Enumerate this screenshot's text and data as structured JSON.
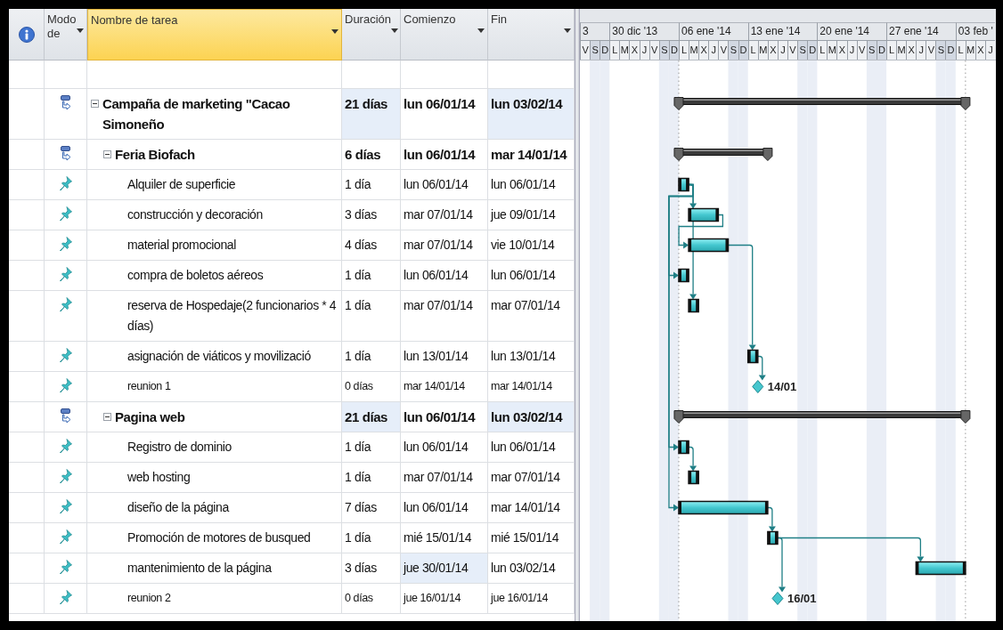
{
  "columns": [
    {
      "label": "Modo de",
      "selected": false
    },
    {
      "label": "Nombre de tarea",
      "selected": true
    },
    {
      "label": "Duración",
      "selected": false
    },
    {
      "label": "Comienzo",
      "selected": false
    },
    {
      "label": "Fin",
      "selected": false
    }
  ],
  "timescale": {
    "weeks": [
      {
        "label": "3",
        "days": [
          {
            "label": "V",
            "weekend": false
          },
          {
            "label": "S",
            "weekend": true
          },
          {
            "label": "D",
            "weekend": true
          }
        ]
      },
      {
        "label": "30 dic '13",
        "days": [
          {
            "label": "L",
            "weekend": false
          },
          {
            "label": "M",
            "weekend": false
          },
          {
            "label": "X",
            "weekend": false
          },
          {
            "label": "J",
            "weekend": false
          },
          {
            "label": "V",
            "weekend": false
          },
          {
            "label": "S",
            "weekend": true
          },
          {
            "label": "D",
            "weekend": true
          }
        ]
      },
      {
        "label": "06 ene '14",
        "days": [
          {
            "label": "L",
            "weekend": false
          },
          {
            "label": "M",
            "weekend": false
          },
          {
            "label": "X",
            "weekend": false
          },
          {
            "label": "J",
            "weekend": false
          },
          {
            "label": "V",
            "weekend": false
          },
          {
            "label": "S",
            "weekend": true
          },
          {
            "label": "D",
            "weekend": true
          }
        ]
      },
      {
        "label": "13 ene '14",
        "days": [
          {
            "label": "L",
            "weekend": false
          },
          {
            "label": "M",
            "weekend": false
          },
          {
            "label": "X",
            "weekend": false
          },
          {
            "label": "J",
            "weekend": false
          },
          {
            "label": "V",
            "weekend": false
          },
          {
            "label": "S",
            "weekend": true
          },
          {
            "label": "D",
            "weekend": true
          }
        ]
      },
      {
        "label": "20 ene '14",
        "days": [
          {
            "label": "L",
            "weekend": false
          },
          {
            "label": "M",
            "weekend": false
          },
          {
            "label": "X",
            "weekend": false
          },
          {
            "label": "J",
            "weekend": false
          },
          {
            "label": "V",
            "weekend": false
          },
          {
            "label": "S",
            "weekend": true
          },
          {
            "label": "D",
            "weekend": true
          }
        ]
      },
      {
        "label": "27 ene '14",
        "days": [
          {
            "label": "L",
            "weekend": false
          },
          {
            "label": "M",
            "weekend": false
          },
          {
            "label": "X",
            "weekend": false
          },
          {
            "label": "J",
            "weekend": false
          },
          {
            "label": "V",
            "weekend": false
          },
          {
            "label": "S",
            "weekend": true
          },
          {
            "label": "D",
            "weekend": true
          }
        ]
      },
      {
        "label": "03 feb '",
        "days": [
          {
            "label": "L",
            "weekend": false
          },
          {
            "label": "M",
            "weekend": false
          },
          {
            "label": "X",
            "weekend": false
          },
          {
            "label": "J",
            "weekend": false
          }
        ]
      }
    ]
  },
  "tasks": [
    {
      "name": "Campaña de marketing \"Cacao Simoneño",
      "kind": "summary",
      "manually_scheduled": false,
      "expanded": true,
      "duration": {
        "text": "21 días",
        "highlighted": true
      },
      "start": {
        "text": "lun 06/01/14",
        "highlighted": false
      },
      "finish": {
        "text": "lun 03/02/14",
        "highlighted": true
      },
      "children": [
        {
          "name": "Feria Biofach",
          "kind": "summary",
          "manually_scheduled": false,
          "expanded": true,
          "duration": {
            "text": "6 días",
            "highlighted": false
          },
          "start": {
            "text": "lun 06/01/14",
            "highlighted": false
          },
          "finish": {
            "text": "mar 14/01/14",
            "highlighted": false
          },
          "children": [
            {
              "name": "Alquiler de superficie",
              "kind": "task",
              "manually_scheduled": true,
              "duration": {
                "text": "1 día",
                "highlighted": false
              },
              "start": {
                "text": "lun 06/01/14",
                "highlighted": false
              },
              "finish": {
                "text": "lun 06/01/14",
                "highlighted": false
              }
            },
            {
              "name": "construcción y decoración",
              "kind": "task",
              "manually_scheduled": true,
              "duration": {
                "text": "3 días",
                "highlighted": false
              },
              "start": {
                "text": "mar 07/01/14",
                "highlighted": false
              },
              "finish": {
                "text": "jue 09/01/14",
                "highlighted": false
              }
            },
            {
              "name": "material promocional",
              "kind": "task",
              "manually_scheduled": true,
              "duration": {
                "text": "4 días",
                "highlighted": false
              },
              "start": {
                "text": "mar 07/01/14",
                "highlighted": false
              },
              "finish": {
                "text": "vie 10/01/14",
                "highlighted": false
              }
            },
            {
              "name": "compra de boletos aéreos",
              "kind": "task",
              "manually_scheduled": true,
              "duration": {
                "text": "1 día",
                "highlighted": false
              },
              "start": {
                "text": "lun 06/01/14",
                "highlighted": false
              },
              "finish": {
                "text": "lun 06/01/14",
                "highlighted": false
              }
            },
            {
              "name": "reserva de Hospedaje(2 funcionarios * 4 días)",
              "kind": "task",
              "manually_scheduled": true,
              "duration": {
                "text": "1 día",
                "highlighted": false
              },
              "start": {
                "text": "mar 07/01/14",
                "highlighted": false
              },
              "finish": {
                "text": "mar 07/01/14",
                "highlighted": false
              }
            },
            {
              "name": "asignación de viáticos y movilizació",
              "kind": "task",
              "manually_scheduled": true,
              "duration": {
                "text": "1 día",
                "highlighted": false
              },
              "start": {
                "text": "lun 13/01/14",
                "highlighted": false
              },
              "finish": {
                "text": "lun 13/01/14",
                "highlighted": false
              }
            },
            {
              "name": "reunion 1",
              "kind": "milestone",
              "manually_scheduled": true,
              "gantt_label": "14/01",
              "duration": {
                "text": "0 días",
                "highlighted": false
              },
              "start": {
                "text": "mar 14/01/14",
                "highlighted": false
              },
              "finish": {
                "text": "mar 14/01/14",
                "highlighted": false
              }
            }
          ]
        },
        {
          "name": "Pagina web",
          "kind": "summary",
          "manually_scheduled": false,
          "expanded": true,
          "duration": {
            "text": "21 días",
            "highlighted": true
          },
          "start": {
            "text": "lun 06/01/14",
            "highlighted": false
          },
          "finish": {
            "text": "lun 03/02/14",
            "highlighted": true
          },
          "children": [
            {
              "name": "Registro de dominio",
              "kind": "task",
              "manually_scheduled": true,
              "duration": {
                "text": "1 día",
                "highlighted": false
              },
              "start": {
                "text": "lun 06/01/14",
                "highlighted": false
              },
              "finish": {
                "text": "lun 06/01/14",
                "highlighted": false
              }
            },
            {
              "name": "web hosting",
              "kind": "task",
              "manually_scheduled": true,
              "duration": {
                "text": "1 día",
                "highlighted": false
              },
              "start": {
                "text": "mar 07/01/14",
                "highlighted": false
              },
              "finish": {
                "text": "mar 07/01/14",
                "highlighted": false
              }
            },
            {
              "name": "diseño de la página",
              "kind": "task",
              "manually_scheduled": true,
              "duration": {
                "text": "7 días",
                "highlighted": false
              },
              "start": {
                "text": "lun 06/01/14",
                "highlighted": false
              },
              "finish": {
                "text": "mar 14/01/14",
                "highlighted": false
              }
            },
            {
              "name": "Promoción de motores de busqued",
              "kind": "task",
              "manually_scheduled": true,
              "duration": {
                "text": "1 día",
                "highlighted": false
              },
              "start": {
                "text": "mié 15/01/14",
                "highlighted": false
              },
              "finish": {
                "text": "mié 15/01/14",
                "highlighted": false
              }
            },
            {
              "name": "mantenimiento de la página",
              "kind": "task",
              "manually_scheduled": true,
              "duration": {
                "text": "3 días",
                "highlighted": false
              },
              "start": {
                "text": "jue 30/01/14",
                "highlighted": true
              },
              "finish": {
                "text": "lun 03/02/14",
                "highlighted": false
              }
            },
            {
              "name": "reunion 2",
              "kind": "milestone",
              "manually_scheduled": true,
              "gantt_label": "16/01",
              "duration": {
                "text": "0 días",
                "highlighted": false
              },
              "start": {
                "text": "jue 16/01/14",
                "highlighted": false
              },
              "finish": {
                "text": "jue 16/01/14",
                "highlighted": false
              }
            }
          ]
        }
      ]
    }
  ]
}
